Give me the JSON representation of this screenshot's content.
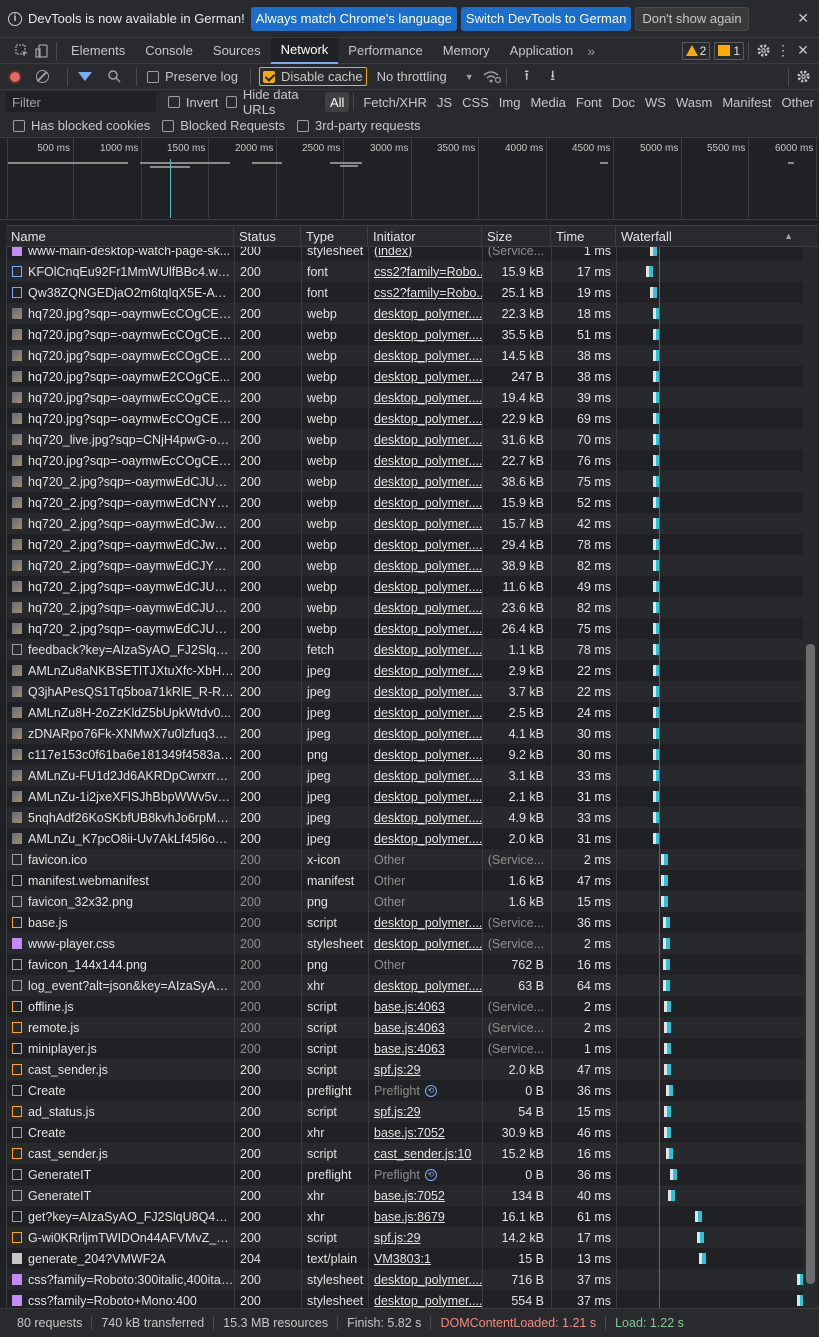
{
  "infobar": {
    "message": "DevTools is now available in German!",
    "btn_match": "Always match Chrome's language",
    "btn_switch": "Switch DevTools to German",
    "btn_dismiss": "Don't show again"
  },
  "tabs": {
    "elements": "Elements",
    "console": "Console",
    "sources": "Sources",
    "network": "Network",
    "performance": "Performance",
    "memory": "Memory",
    "application": "Application",
    "warnings": "2",
    "issues": "1"
  },
  "toolbar": {
    "preserve_log": "Preserve log",
    "disable_cache": "Disable cache",
    "throttling": "No throttling"
  },
  "filters": {
    "placeholder": "Filter",
    "invert": "Invert",
    "hide_data_urls": "Hide data URLs",
    "types": [
      "All",
      "Fetch/XHR",
      "JS",
      "CSS",
      "Img",
      "Media",
      "Font",
      "Doc",
      "WS",
      "Wasm",
      "Manifest",
      "Other"
    ],
    "blocked_cookies": "Has blocked cookies",
    "blocked_requests": "Blocked Requests",
    "third_party": "3rd-party requests"
  },
  "overview": {
    "ticks": [
      "500 ms",
      "1000 ms",
      "1500 ms",
      "2000 ms",
      "2500 ms",
      "3000 ms",
      "3500 ms",
      "4000 ms",
      "4500 ms",
      "5000 ms",
      "5500 ms",
      "6000 ms"
    ]
  },
  "columns": {
    "name": "Name",
    "status": "Status",
    "type": "Type",
    "initiator": "Initiator",
    "size": "Size",
    "time": "Time",
    "waterfall": "Waterfall"
  },
  "rows": [
    {
      "name": "www-main-desktop-watch-page-sk...",
      "status": "200",
      "type": "stylesheet",
      "initiator": "(index)",
      "size": "(Service...",
      "time": "1 ms",
      "icon": "css",
      "wf": 0.18
    },
    {
      "name": "KFOlCnqEu92Fr1MmWUlfBBc4.woff2",
      "status": "200",
      "type": "font",
      "initiator": "css2?family=Robo...",
      "size": "15.9 kB",
      "time": "17 ms",
      "icon": "font",
      "wf": 0.16
    },
    {
      "name": "Qw38ZQNGEDjaO2m6tqIqX5E-AVS...",
      "status": "200",
      "type": "font",
      "initiator": "css2?family=Robo...",
      "size": "25.1 kB",
      "time": "19 ms",
      "icon": "font",
      "wf": 0.18
    },
    {
      "name": "hq720.jpg?sqp=-oaymwEcCOgCEM...",
      "status": "200",
      "type": "webp",
      "initiator": "desktop_polymer....",
      "size": "22.3 kB",
      "time": "18 ms",
      "icon": "img",
      "wf": 0.2
    },
    {
      "name": "hq720.jpg?sqp=-oaymwEcCOgCEM...",
      "status": "200",
      "type": "webp",
      "initiator": "desktop_polymer....",
      "size": "35.5 kB",
      "time": "51 ms",
      "icon": "img",
      "wf": 0.2
    },
    {
      "name": "hq720.jpg?sqp=-oaymwEcCOgCEM...",
      "status": "200",
      "type": "webp",
      "initiator": "desktop_polymer....",
      "size": "14.5 kB",
      "time": "38 ms",
      "icon": "img",
      "wf": 0.2
    },
    {
      "name": "hq720.jpg?sqp=-oaymwE2COgCE...",
      "status": "200",
      "type": "webp",
      "initiator": "desktop_polymer....",
      "size": "247 B",
      "time": "38 ms",
      "icon": "img",
      "wf": 0.2
    },
    {
      "name": "hq720.jpg?sqp=-oaymwEcCOgCEM...",
      "status": "200",
      "type": "webp",
      "initiator": "desktop_polymer....",
      "size": "19.4 kB",
      "time": "39 ms",
      "icon": "img",
      "wf": 0.2
    },
    {
      "name": "hq720.jpg?sqp=-oaymwEcCOgCEM...",
      "status": "200",
      "type": "webp",
      "initiator": "desktop_polymer....",
      "size": "22.9 kB",
      "time": "69 ms",
      "icon": "img",
      "wf": 0.2
    },
    {
      "name": "hq720_live.jpg?sqp=CNjH4pwG-oa...",
      "status": "200",
      "type": "webp",
      "initiator": "desktop_polymer....",
      "size": "31.6 kB",
      "time": "70 ms",
      "icon": "img",
      "wf": 0.2
    },
    {
      "name": "hq720.jpg?sqp=-oaymwEcCOgCEM...",
      "status": "200",
      "type": "webp",
      "initiator": "desktop_polymer....",
      "size": "22.7 kB",
      "time": "76 ms",
      "icon": "img",
      "wf": 0.2
    },
    {
      "name": "hq720_2.jpg?sqp=-oaymwEdCJUDE...",
      "status": "200",
      "type": "webp",
      "initiator": "desktop_polymer....",
      "size": "38.6 kB",
      "time": "75 ms",
      "icon": "img",
      "wf": 0.2
    },
    {
      "name": "hq720_2.jpg?sqp=-oaymwEdCNYC...",
      "status": "200",
      "type": "webp",
      "initiator": "desktop_polymer....",
      "size": "15.9 kB",
      "time": "52 ms",
      "icon": "img",
      "wf": 0.2
    },
    {
      "name": "hq720_2.jpg?sqp=-oaymwEdCJwEE...",
      "status": "200",
      "type": "webp",
      "initiator": "desktop_polymer....",
      "size": "15.7 kB",
      "time": "42 ms",
      "icon": "img",
      "wf": 0.2
    },
    {
      "name": "hq720_2.jpg?sqp=-oaymwEdCJwEE...",
      "status": "200",
      "type": "webp",
      "initiator": "desktop_polymer....",
      "size": "29.4 kB",
      "time": "78 ms",
      "icon": "img",
      "wf": 0.2
    },
    {
      "name": "hq720_2.jpg?sqp=-oaymwEdCJYDE...",
      "status": "200",
      "type": "webp",
      "initiator": "desktop_polymer....",
      "size": "38.9 kB",
      "time": "82 ms",
      "icon": "img",
      "wf": 0.2
    },
    {
      "name": "hq720_2.jpg?sqp=-oaymwEdCJUDE...",
      "status": "200",
      "type": "webp",
      "initiator": "desktop_polymer....",
      "size": "11.6 kB",
      "time": "49 ms",
      "icon": "img",
      "wf": 0.2
    },
    {
      "name": "hq720_2.jpg?sqp=-oaymwEdCJUDE...",
      "status": "200",
      "type": "webp",
      "initiator": "desktop_polymer....",
      "size": "23.6 kB",
      "time": "82 ms",
      "icon": "img",
      "wf": 0.2
    },
    {
      "name": "hq720_2.jpg?sqp=-oaymwEdCJUDE...",
      "status": "200",
      "type": "webp",
      "initiator": "desktop_polymer....",
      "size": "26.4 kB",
      "time": "75 ms",
      "icon": "img",
      "wf": 0.2
    },
    {
      "name": "feedback?key=AIzaSyAO_FJ2SlqU8...",
      "status": "200",
      "type": "fetch",
      "initiator": "desktop_polymer....",
      "size": "1.1 kB",
      "time": "78 ms",
      "icon": "doc",
      "wf": 0.2
    },
    {
      "name": "AMLnZu8aNKBSETlTJXtuXfc-XbHlo...",
      "status": "200",
      "type": "jpeg",
      "initiator": "desktop_polymer....",
      "size": "2.9 kB",
      "time": "22 ms",
      "icon": "img",
      "wf": 0.2
    },
    {
      "name": "Q3jhAPesQS1Tq5boa71kRlE_R-R-7...",
      "status": "200",
      "type": "jpeg",
      "initiator": "desktop_polymer....",
      "size": "3.7 kB",
      "time": "22 ms",
      "icon": "img",
      "wf": 0.2
    },
    {
      "name": "AMLnZu8H-2oZzKldZ5bUpkWtdv0...",
      "status": "200",
      "type": "jpeg",
      "initiator": "desktop_polymer....",
      "size": "2.5 kB",
      "time": "24 ms",
      "icon": "img",
      "wf": 0.2
    },
    {
      "name": "zDNARpo76Fk-XNMwX7u0lzfuq3N...",
      "status": "200",
      "type": "jpeg",
      "initiator": "desktop_polymer....",
      "size": "4.1 kB",
      "time": "30 ms",
      "icon": "img",
      "wf": 0.2
    },
    {
      "name": "c117e153c0f61ba6e181349f4583a3...",
      "status": "200",
      "type": "png",
      "initiator": "desktop_polymer....",
      "size": "9.2 kB",
      "time": "30 ms",
      "icon": "img",
      "wf": 0.2
    },
    {
      "name": "AMLnZu-FU1d2Jd6AKRDpCwrxrrao...",
      "status": "200",
      "type": "jpeg",
      "initiator": "desktop_polymer....",
      "size": "3.1 kB",
      "time": "33 ms",
      "icon": "img",
      "wf": 0.2
    },
    {
      "name": "AMLnZu-1i2jxeXFlSJhBbpWWv5vV...",
      "status": "200",
      "type": "jpeg",
      "initiator": "desktop_polymer....",
      "size": "2.1 kB",
      "time": "31 ms",
      "icon": "img",
      "wf": 0.2
    },
    {
      "name": "5nqhAdf26KoSKbfUB8kvhJo6rpMQ...",
      "status": "200",
      "type": "jpeg",
      "initiator": "desktop_polymer....",
      "size": "4.9 kB",
      "time": "33 ms",
      "icon": "img",
      "wf": 0.2
    },
    {
      "name": "AMLnZu_K7pcO8ii-Uv7AkLf45l6oLZ...",
      "status": "200",
      "type": "jpeg",
      "initiator": "desktop_polymer....",
      "size": "2.0 kB",
      "time": "31 ms",
      "icon": "img",
      "wf": 0.2
    },
    {
      "name": "favicon.ico",
      "status": "200",
      "type": "x-icon",
      "initiator": "Other",
      "size": "(Service...",
      "time": "2 ms",
      "icon": "doc",
      "wf": 0.24,
      "dimstatus": true
    },
    {
      "name": "manifest.webmanifest",
      "status": "200",
      "type": "manifest",
      "initiator": "Other",
      "size": "1.6 kB",
      "time": "47 ms",
      "icon": "doc",
      "wf": 0.24,
      "dimstatus": true
    },
    {
      "name": "favicon_32x32.png",
      "status": "200",
      "type": "png",
      "initiator": "Other",
      "size": "1.6 kB",
      "time": "15 ms",
      "icon": "doc",
      "wf": 0.24,
      "dimstatus": true
    },
    {
      "name": "base.js",
      "status": "200",
      "type": "script",
      "initiator": "desktop_polymer....",
      "size": "(Service...",
      "time": "36 ms",
      "icon": "script",
      "wf": 0.25,
      "dimstatus": true
    },
    {
      "name": "www-player.css",
      "status": "200",
      "type": "stylesheet",
      "initiator": "desktop_polymer....",
      "size": "(Service...",
      "time": "2 ms",
      "icon": "css",
      "wf": 0.25,
      "dimstatus": true
    },
    {
      "name": "favicon_144x144.png",
      "status": "200",
      "type": "png",
      "initiator": "Other",
      "size": "762 B",
      "time": "16 ms",
      "icon": "doc",
      "wf": 0.25,
      "dimstatus": true
    },
    {
      "name": "log_event?alt=json&key=AIzaSyAO...",
      "status": "200",
      "type": "xhr",
      "initiator": "desktop_polymer....",
      "size": "63 B",
      "time": "64 ms",
      "icon": "doc",
      "wf": 0.25,
      "dimstatus": true
    },
    {
      "name": "offline.js",
      "status": "200",
      "type": "script",
      "initiator": "base.js:4063",
      "size": "(Service...",
      "time": "2 ms",
      "icon": "script",
      "wf": 0.26,
      "dimstatus": true
    },
    {
      "name": "remote.js",
      "status": "200",
      "type": "script",
      "initiator": "base.js:4063",
      "size": "(Service...",
      "time": "2 ms",
      "icon": "script",
      "wf": 0.26,
      "dimstatus": true
    },
    {
      "name": "miniplayer.js",
      "status": "200",
      "type": "script",
      "initiator": "base.js:4063",
      "size": "(Service...",
      "time": "1 ms",
      "icon": "script",
      "wf": 0.26,
      "dimstatus": true
    },
    {
      "name": "cast_sender.js",
      "status": "200",
      "type": "script",
      "initiator": "spf.js:29",
      "size": "2.0 kB",
      "time": "47 ms",
      "icon": "script",
      "wf": 0.26
    },
    {
      "name": "Create",
      "status": "200",
      "type": "preflight",
      "initiator": "Preflight",
      "size": "0 B",
      "time": "36 ms",
      "icon": "doc",
      "wf": 0.27,
      "preflight": true
    },
    {
      "name": "ad_status.js",
      "status": "200",
      "type": "script",
      "initiator": "spf.js:29",
      "size": "54 B",
      "time": "15 ms",
      "icon": "script",
      "wf": 0.26
    },
    {
      "name": "Create",
      "status": "200",
      "type": "xhr",
      "initiator": "base.js:7052",
      "size": "30.9 kB",
      "time": "46 ms",
      "icon": "doc",
      "wf": 0.26
    },
    {
      "name": "cast_sender.js",
      "status": "200",
      "type": "script",
      "initiator": "cast_sender.js:10",
      "size": "15.2 kB",
      "time": "16 ms",
      "icon": "script",
      "wf": 0.27
    },
    {
      "name": "GenerateIT",
      "status": "200",
      "type": "preflight",
      "initiator": "Preflight",
      "size": "0 B",
      "time": "36 ms",
      "icon": "doc",
      "wf": 0.29,
      "preflight": true
    },
    {
      "name": "GenerateIT",
      "status": "200",
      "type": "xhr",
      "initiator": "base.js:7052",
      "size": "134 B",
      "time": "40 ms",
      "icon": "doc",
      "wf": 0.28
    },
    {
      "name": "get?key=AIzaSyAO_FJ2SlqU8Q4STE...",
      "status": "200",
      "type": "xhr",
      "initiator": "base.js:8679",
      "size": "16.1 kB",
      "time": "61 ms",
      "icon": "doc",
      "wf": 0.43
    },
    {
      "name": "G-wi0KRrljmTWIDOn44AFVMvZ_aK...",
      "status": "200",
      "type": "script",
      "initiator": "spf.js:29",
      "size": "14.2 kB",
      "time": "17 ms",
      "icon": "script",
      "wf": 0.44
    },
    {
      "name": "generate_204?VMWF2A",
      "status": "204",
      "type": "text/plain",
      "initiator": "VM3803:1",
      "size": "15 B",
      "time": "13 ms",
      "icon": "plain",
      "wf": 0.45
    },
    {
      "name": "css?family=Roboto:300italic,400itali...",
      "status": "200",
      "type": "stylesheet",
      "initiator": "desktop_polymer....",
      "size": "716 B",
      "time": "37 ms",
      "icon": "css",
      "wf": 0.99
    },
    {
      "name": "css?family=Roboto+Mono:400",
      "status": "200",
      "type": "stylesheet",
      "initiator": "desktop_polymer....",
      "size": "554 B",
      "time": "37 ms",
      "icon": "css",
      "wf": 0.99
    }
  ],
  "status": {
    "requests": "80 requests",
    "transferred": "740 kB transferred",
    "resources": "15.3 MB resources",
    "finish": "Finish: 5.82 s",
    "dcl": "DOMContentLoaded: 1.21 s",
    "load": "Load: 1.22 s"
  }
}
